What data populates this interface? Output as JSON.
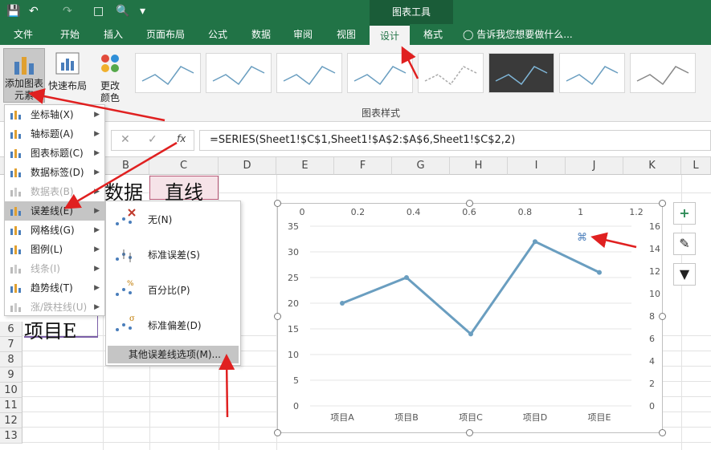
{
  "titlebar": {
    "contextual_tab": "图表工具"
  },
  "tabs": [
    "文件",
    "开始",
    "插入",
    "页面布局",
    "公式",
    "数据",
    "审阅",
    "视图",
    "设计",
    "格式"
  ],
  "tell_me": "告诉我您想要做什么...",
  "ribbon": {
    "add_element": [
      "添加图表",
      "元素"
    ],
    "quick_layout": "快速布局",
    "change_colors": [
      "更改",
      "颜色"
    ],
    "styles_group": "图表样式"
  },
  "formula": {
    "name_box": "",
    "text": "=SERIES(Sheet1!$C$1,Sheet1!$A$2:$A$6,Sheet1!$C$2,2)",
    "fx": "fx"
  },
  "columns": [
    "B",
    "C",
    "D",
    "E",
    "F",
    "G",
    "H",
    "I",
    "J",
    "K",
    "L"
  ],
  "rows": [
    "6",
    "7",
    "8",
    "9",
    "10",
    "11",
    "12",
    "13"
  ],
  "cells": {
    "b1": "数据",
    "c1": "直线",
    "a6": "项目E"
  },
  "menu_primary": [
    {
      "label": "坐标轴(X)",
      "disabled": false,
      "highlight": false
    },
    {
      "label": "轴标题(A)",
      "disabled": false,
      "highlight": false
    },
    {
      "label": "图表标题(C)",
      "disabled": false,
      "highlight": false
    },
    {
      "label": "数据标签(D)",
      "disabled": false,
      "highlight": false
    },
    {
      "label": "数据表(B)",
      "disabled": true,
      "highlight": false
    },
    {
      "label": "误差线(E)",
      "disabled": false,
      "highlight": true
    },
    {
      "label": "网格线(G)",
      "disabled": false,
      "highlight": false
    },
    {
      "label": "图例(L)",
      "disabled": false,
      "highlight": false
    },
    {
      "label": "线条(I)",
      "disabled": true,
      "highlight": false
    },
    {
      "label": "趋势线(T)",
      "disabled": false,
      "highlight": false
    },
    {
      "label": "涨/跌柱线(U)",
      "disabled": true,
      "highlight": false
    }
  ],
  "menu_errorbars": [
    "无(N)",
    "标准误差(S)",
    "百分比(P)",
    "标准偏差(D)"
  ],
  "menu_more": "其他误差线选项(M)...",
  "chart_data": {
    "type": "line",
    "categories": [
      "项目A",
      "项目B",
      "项目C",
      "项目D",
      "项目E"
    ],
    "series": [
      {
        "values": [
          20,
          25,
          14,
          32,
          26
        ]
      }
    ],
    "y_left_ticks": [
      0,
      5,
      10,
      15,
      20,
      25,
      30,
      35
    ],
    "y_left_range": [
      0,
      35
    ],
    "y_right_ticks": [
      0,
      2,
      4,
      6,
      8,
      10,
      12,
      14,
      16
    ],
    "x_top_ticks": [
      "0",
      "0.2",
      "0.4",
      "0.6",
      "0.8",
      "1",
      "1.2"
    ],
    "grid": true,
    "line_color": "#6a9ec0"
  },
  "colors": {
    "excel_green": "#217346",
    "arrow_red": "#e02020"
  }
}
